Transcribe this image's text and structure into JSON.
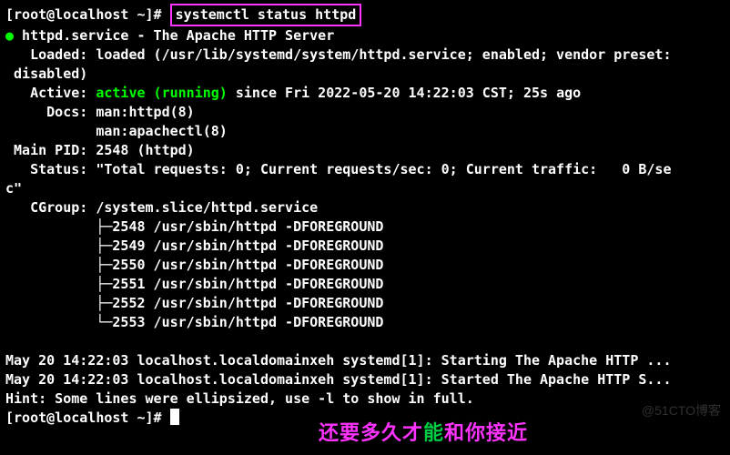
{
  "prompt": {
    "user_host": "[root@localhost ~]# ",
    "command": "systemctl status httpd"
  },
  "svc": {
    "bullet": "●",
    "header": " httpd.service - The Apache HTTP Server",
    "loaded": "   Loaded: loaded (/usr/lib/systemd/system/httpd.service; enabled; vendor preset:",
    "loaded2": " disabled)",
    "active_lbl": "   Active: ",
    "active_val": "active (running)",
    "active_rest": " since Fri 2022-05-20 14:22:03 CST; 25s ago",
    "docs1": "     Docs: man:httpd(8)",
    "docs2": "           man:apachectl(8)",
    "mainpid": " Main PID: 2548 (httpd)",
    "status1": "   Status: \"Total requests: 0; Current requests/sec: 0; Current traffic:   0 B/se",
    "status2": "c\"",
    "cgroup": "   CGroup: /system.slice/httpd.service"
  },
  "procs": [
    "           ├─2548 /usr/sbin/httpd -DFOREGROUND",
    "           ├─2549 /usr/sbin/httpd -DFOREGROUND",
    "           ├─2550 /usr/sbin/httpd -DFOREGROUND",
    "           ├─2551 /usr/sbin/httpd -DFOREGROUND",
    "           ├─2552 /usr/sbin/httpd -DFOREGROUND",
    "           └─2553 /usr/sbin/httpd -DFOREGROUND"
  ],
  "log": [
    "May 20 14:22:03 localhost.localdomainxeh systemd[1]: Starting The Apache HTTP ...",
    "May 20 14:22:03 localhost.localdomainxeh systemd[1]: Started The Apache HTTP S...",
    "Hint: Some lines were ellipsized, use -l to show in full."
  ],
  "prompt2": "[root@localhost ~]# ",
  "overlay": {
    "pink1": "还要多久才",
    "green": "能",
    "pink2": "和你接近"
  },
  "watermark": "@51CTO博客"
}
